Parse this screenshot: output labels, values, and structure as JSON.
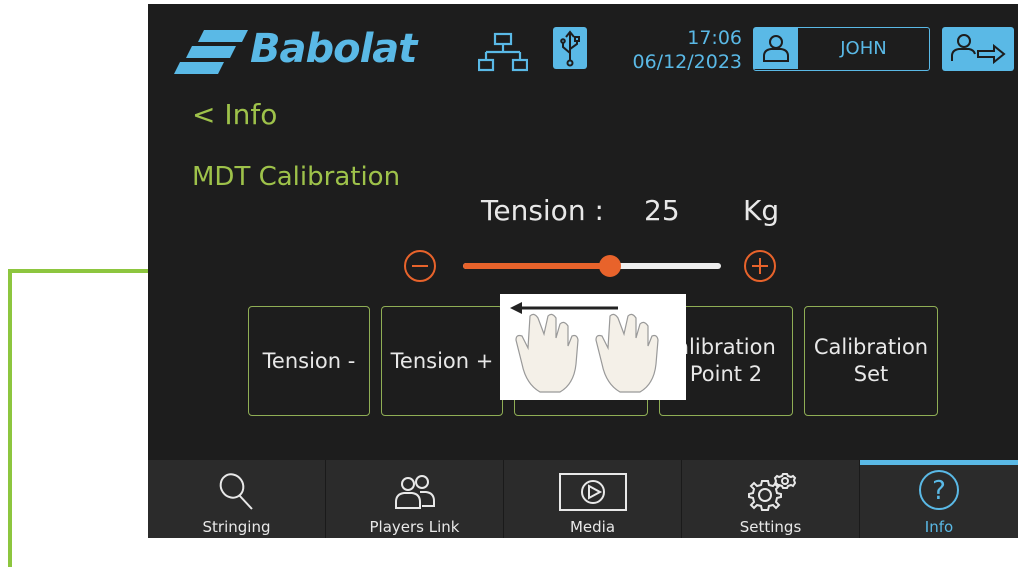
{
  "header": {
    "brand": "Babolat",
    "time": "17:06",
    "date": "06/12/2023",
    "user_name": "JOHN",
    "icons": [
      "network-icon",
      "usb-icon",
      "user-icon",
      "logout-icon"
    ]
  },
  "back_label": "< Info",
  "section_title": "MDT Calibration",
  "tension": {
    "label": "Tension :",
    "value": "25",
    "unit": "Kg",
    "slider_fraction": 0.57
  },
  "buttons": [
    {
      "label": "Tension -"
    },
    {
      "label": "Tension +"
    },
    {
      "label": ""
    },
    {
      "label": "alibration\nPoint 2"
    },
    {
      "label": "Calibration\nSet"
    }
  ],
  "nav": {
    "items": [
      {
        "label": "Stringing",
        "icon": "racket-icon"
      },
      {
        "label": "Players Link",
        "icon": "players-icon"
      },
      {
        "label": "Media",
        "icon": "media-icon"
      },
      {
        "label": "Settings",
        "icon": "settings-icon"
      },
      {
        "label": "Info",
        "icon": "info-icon"
      }
    ],
    "active": "Info"
  },
  "colors": {
    "accent_blue": "#5ab9e6",
    "accent_green": "#9ec24a",
    "accent_orange": "#e8632b",
    "annotation_green": "#8dc63f",
    "background": "#1d1d1d"
  }
}
